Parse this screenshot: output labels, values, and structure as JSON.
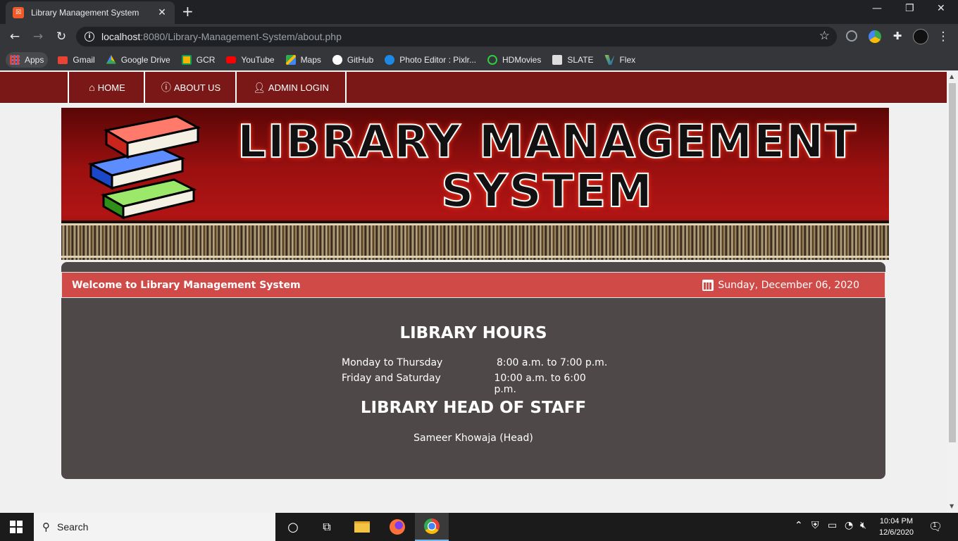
{
  "browser": {
    "tab_title": "Library Management System",
    "tab_favicon": "xampp-icon",
    "new_tab": "+",
    "url_host": "localhost",
    "url_rest": ":8080/Library-Management-System/about.php"
  },
  "bookmarks": [
    {
      "label": "Apps",
      "icon": "apps-grid-icon",
      "color": "#ea4335"
    },
    {
      "label": "Gmail",
      "icon": "gmail-icon",
      "color": "#ea4335"
    },
    {
      "label": "Google Drive",
      "icon": "drive-icon",
      "color": "#fbbc04"
    },
    {
      "label": "GCR",
      "icon": "classroom-icon",
      "color": "#f4b400"
    },
    {
      "label": "YouTube",
      "icon": "youtube-icon",
      "color": "#ff0000"
    },
    {
      "label": "Maps",
      "icon": "maps-icon",
      "color": "#34a853"
    },
    {
      "label": "GitHub",
      "icon": "github-icon",
      "color": "#ffffff"
    },
    {
      "label": "Photo Editor : Pixlr...",
      "icon": "pixlr-icon",
      "color": "#1e88e5"
    },
    {
      "label": "HDMovies",
      "icon": "hdmovies-icon",
      "color": "#2ecc40"
    },
    {
      "label": "SLATE",
      "icon": "slate-icon",
      "color": "#dddddd"
    },
    {
      "label": "Flex",
      "icon": "flex-icon",
      "color": "#8bc34a"
    }
  ],
  "site_nav": {
    "home": "HOME",
    "about": "ABOUT US",
    "admin": "ADMIN LOGIN"
  },
  "banner": {
    "title_line1": "LIBRARY MANAGEMENT",
    "title_line2": "SYSTEM"
  },
  "panel": {
    "welcome": "Welcome to Library Management System",
    "date": "Sunday, December 06, 2020",
    "hours_title": "LIBRARY HOURS",
    "hours": [
      {
        "days": "Monday to Thursday",
        "time": "8:00 a.m. to 7:00 p.m."
      },
      {
        "days": "Friday and Saturday",
        "time": "10:00 a.m. to 6:00 p.m."
      }
    ],
    "staff_title": "LIBRARY HEAD OF STAFF",
    "staff_name": "Sameer Khowaja (Head)"
  },
  "taskbar": {
    "search_text": "Search",
    "time": "10:04 PM",
    "date": "12/6/2020",
    "notification_count": "1"
  },
  "colors": {
    "nav_bg": "#7a1717",
    "welcome_bar": "#d04a48",
    "panel_bg": "#4f4848"
  }
}
